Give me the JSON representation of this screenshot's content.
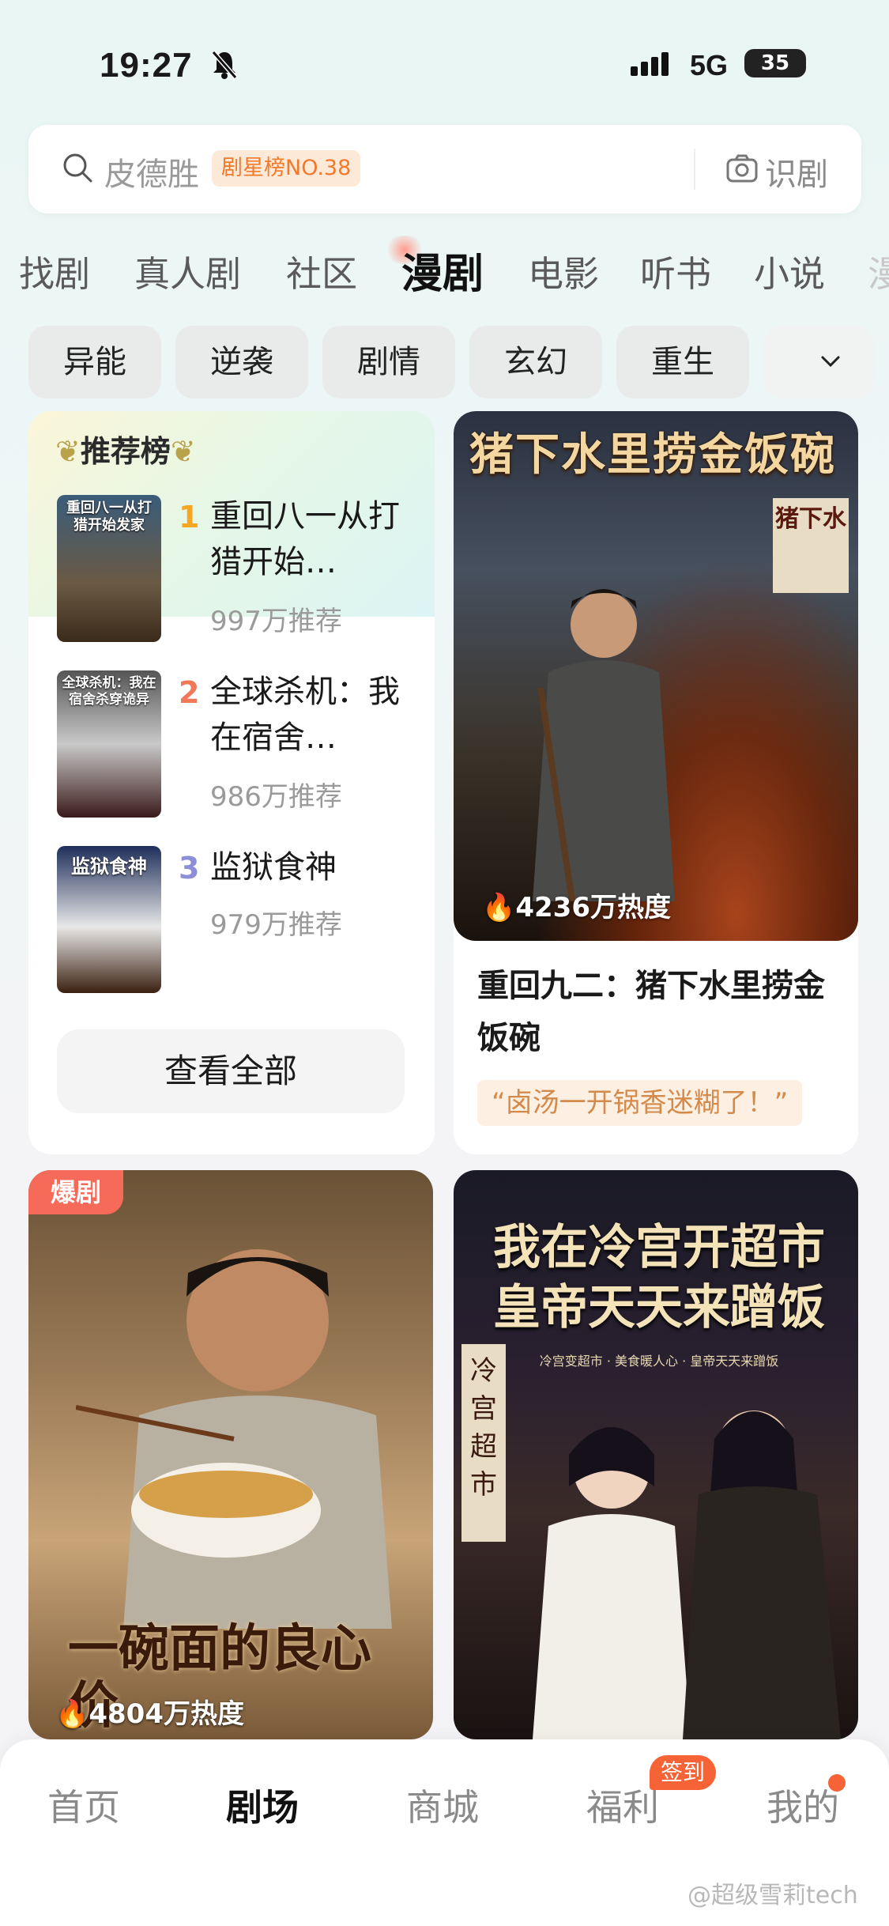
{
  "status_bar": {
    "time": "19:27",
    "network": "5G",
    "battery": "35"
  },
  "search": {
    "query": "皮德胜",
    "badge": "剧星榜NO.38",
    "camera_label": "识剧"
  },
  "tabs": [
    {
      "label": "找剧"
    },
    {
      "label": "真人剧"
    },
    {
      "label": "社区"
    },
    {
      "label": "漫剧",
      "active": true
    },
    {
      "label": "电影"
    },
    {
      "label": "听书"
    },
    {
      "label": "小说"
    },
    {
      "label": "漫"
    }
  ],
  "chips": [
    "异能",
    "逆袭",
    "剧情",
    "玄幻",
    "重生"
  ],
  "ranking": {
    "title": "推荐榜",
    "items": [
      {
        "rank": "1",
        "name": "重回八一从打猎开始…",
        "count": "997万推荐",
        "cover_text": "重回八一从打猎开始发家"
      },
      {
        "rank": "2",
        "name": "全球杀机：我在宿舍…",
        "count": "986万推荐",
        "cover_text": "全球杀机：我在宿舍杀穿诡异"
      },
      {
        "rank": "3",
        "name": "监狱食神",
        "count": "979万推荐",
        "cover_text": "监狱食神"
      }
    ],
    "view_all": "查看全部"
  },
  "feature": {
    "cover_title": "猪下水里捞金饭碗",
    "cover_sign": "猪下水",
    "heat": "4236万热度",
    "title": "重回九二：猪下水里捞金饭碗",
    "quote": "“卤汤一开锅香迷糊了！”"
  },
  "posters": [
    {
      "badge": "爆剧",
      "cover_title": "一碗面的良心价",
      "heat": "4804万热度"
    },
    {
      "cover_title": "我在冷宫开超市皇帝天天来蹭饭",
      "cover_sign": "冷宫超市",
      "cover_subtitle": "冷宫变超市 · 美食暖人心 · 皇帝天天来蹭饭"
    }
  ],
  "bottom_nav": [
    {
      "label": "首页"
    },
    {
      "label": "剧场",
      "active": true
    },
    {
      "label": "商城"
    },
    {
      "label": "福利",
      "badge": "签到"
    },
    {
      "label": "我的"
    }
  ],
  "watermark": "@超级雪莉tech",
  "colors": {
    "accent": "#f66336",
    "rank1": "#f5a623",
    "rank2": "#f0795a",
    "rank3": "#8c8fd8"
  }
}
